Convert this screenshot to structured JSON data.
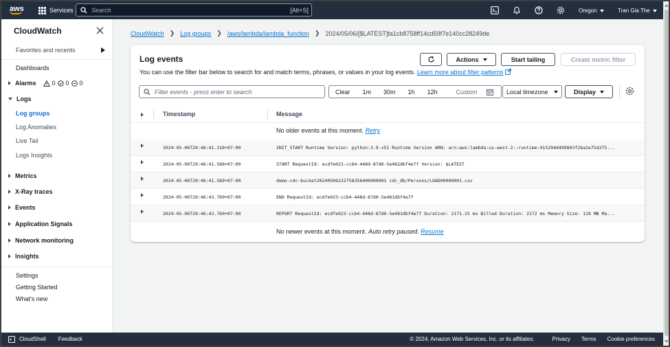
{
  "topbar": {
    "logo": "aws",
    "services_label": "Services",
    "search_placeholder": "Search",
    "search_shortcut": "[Alt+S]",
    "region": "Oregon",
    "user": "Tran Gia The"
  },
  "sidebar": {
    "title": "CloudWatch",
    "favorites": "Favorites and recents",
    "dashboards": "Dashboards",
    "alarms": {
      "label": "Alarms",
      "in_alarm": "0",
      "ok": "0",
      "insufficient": "0"
    },
    "logs": {
      "label": "Logs",
      "items": [
        "Log groups",
        "Log Anomalies",
        "Live Tail",
        "Logs Insights"
      ]
    },
    "sections": [
      "Metrics",
      "X-Ray traces",
      "Events",
      "Application Signals",
      "Network monitoring",
      "Insights"
    ],
    "footer_items": [
      "Settings",
      "Getting Started",
      "What's new"
    ]
  },
  "breadcrumb": {
    "items": [
      "CloudWatch",
      "Log groups",
      "/aws/lambda/lambda_function"
    ],
    "current": "2024/05/06/[$LATEST]fa1cb8758ff14cd59f7e140cc28249de"
  },
  "panel": {
    "title": "Log events",
    "actions_label": "Actions",
    "start_tailing_label": "Start tailing",
    "create_metric_filter_label": "Create metric filter",
    "description": "You can use the filter bar below to search for and match terms, phrases, or values in your log events.",
    "learn_more": "Learn more about filter patterns",
    "filter_placeholder": "Filter events - press enter to search",
    "time_buttons": [
      "Clear",
      "1m",
      "30m",
      "1h",
      "12h"
    ],
    "custom_label": "Custom",
    "timezone_label": "Local timezone",
    "display_label": "Display",
    "columns": {
      "timestamp": "Timestamp",
      "message": "Message"
    },
    "no_older": "No older events at this moment.",
    "retry": "Retry",
    "no_newer": "No newer events at this moment.",
    "auto_retry": "Auto retry paused.",
    "resume": "Resume",
    "events": [
      {
        "timestamp": "2024-05-06T20:46:41.318+07:00",
        "message": "INIT_START Runtime Version: python:3.9.v51 Runtime Version ARN: arn:aws:lambda:us-west-2::runtime:415294d499803f2ba2e75d275..."
      },
      {
        "timestamp": "2024-05-06T20:46:41.588+07:00",
        "message": "START RequestId: ecdfe023-ccb4-448d-87d0-5e481dbf4e7f Version: $LATEST"
      },
      {
        "timestamp": "2024-05-06T20:46:41.589+07:00",
        "message": "demo-cdc-bucket20240506132758356400000001 cdc_db/Persons/LOAD00000001.csv"
      },
      {
        "timestamp": "2024-05-06T20:46:43.760+07:00",
        "message": "END RequestId: ecdfe023-ccb4-448d-87d0-5e481dbf4e7f"
      },
      {
        "timestamp": "2024-05-06T20:46:43.760+07:00",
        "message": "REPORT RequestId: ecdfe023-ccb4-448d-87d0-5e481dbf4e7f Duration: 2171.25 ms Billed Duration: 2172 ms Memory Size: 128 MB Ma..."
      }
    ]
  },
  "bottombar": {
    "cloudshell": "CloudShell",
    "feedback": "Feedback",
    "copyright": "© 2024, Amazon Web Services, Inc. or its affiliates.",
    "links": [
      "Privacy",
      "Terms",
      "Cookie preferences"
    ]
  },
  "colors": {
    "nav_bg": "#232f3e",
    "link": "#0972d3",
    "accent": "#ff9900"
  }
}
